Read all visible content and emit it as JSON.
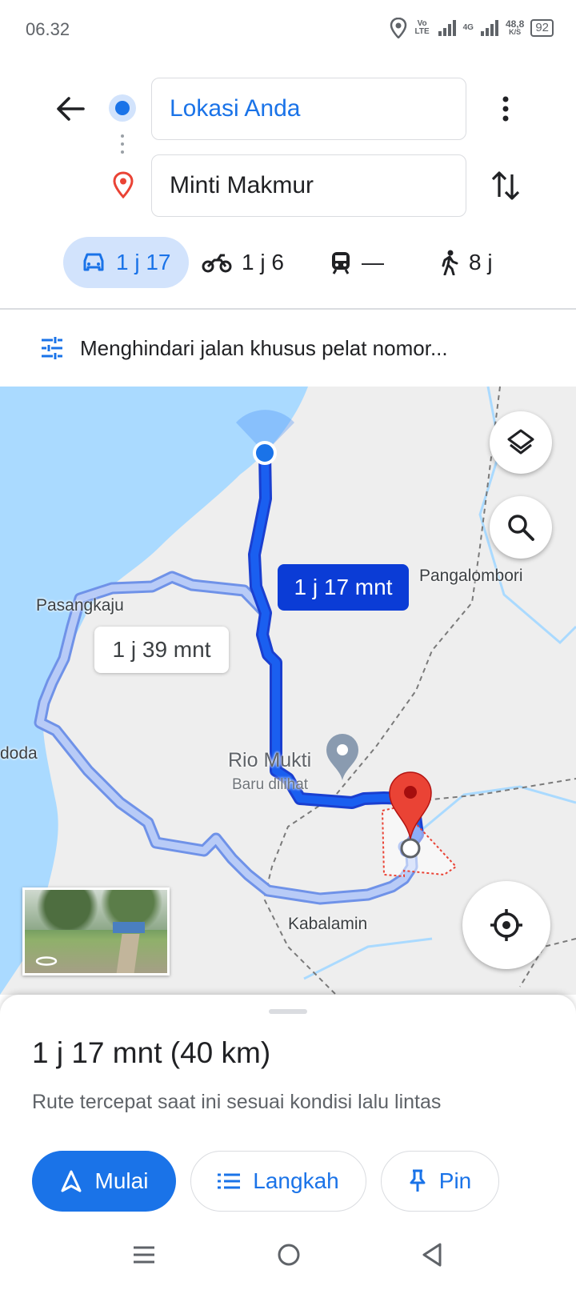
{
  "status_bar": {
    "time": "06.32",
    "volte": "Vo LTE",
    "network": "4G",
    "speed_value": "48,8",
    "speed_unit": "K/S",
    "battery": "92"
  },
  "header": {
    "origin": "Lokasi Anda",
    "destination": "Minti Makmur"
  },
  "modes": [
    {
      "name": "car",
      "label": "1 j 17",
      "active": true
    },
    {
      "name": "motorcycle",
      "label": "1 j 6",
      "active": false
    },
    {
      "name": "transit",
      "label": "—",
      "active": false
    },
    {
      "name": "walk",
      "label": "8 j",
      "active": false
    }
  ],
  "options_text": "Menghindari jalan khusus pelat nomor...",
  "map": {
    "route_primary_label": "1 j 17 mnt",
    "route_alt_label": "1 j 39 mnt",
    "places": {
      "pangalombori": "Pangalombori",
      "pasangkaju": "Pasangkaju",
      "doda": "doda",
      "rio_mukti": "Rio Mukti",
      "rio_mukti_sub": "Baru dilihat",
      "kabalamin": "Kabalamin"
    },
    "colors": {
      "route": "#1a5ff0",
      "route_alt": "#a8c1f5",
      "water": "#aadaff",
      "land": "#eeeeee",
      "pin": "#ea4335"
    }
  },
  "sheet": {
    "summary": "1 j 17 mnt (40 km)",
    "description": "Rute tercepat saat ini sesuai kondisi lalu lintas",
    "buttons": {
      "start": "Mulai",
      "steps": "Langkah",
      "pin": "Pin"
    }
  }
}
